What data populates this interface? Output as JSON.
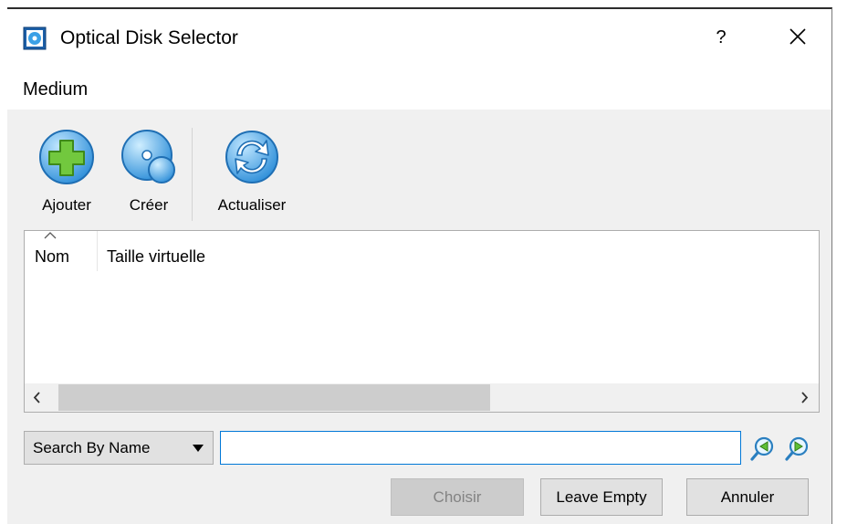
{
  "window": {
    "title": "Optical Disk Selector",
    "help_label": "?"
  },
  "menu": {
    "items": [
      "Medium"
    ]
  },
  "toolbar": {
    "add_label": "Ajouter",
    "create_label": "Créer",
    "refresh_label": "Actualiser"
  },
  "table": {
    "columns": [
      "Nom",
      "Taille virtuelle"
    ],
    "sort_column": "Nom",
    "sort_direction": "ascending",
    "rows": [],
    "hscroll_thumb_fraction": 0.6
  },
  "search": {
    "mode": "Search By Name",
    "value": "",
    "placeholder": ""
  },
  "buttons": {
    "choose": "Choisir",
    "leave_empty": "Leave Empty",
    "cancel": "Annuler"
  },
  "icons": {
    "app": "virtualbox-disk-icon",
    "add": "add-disk-icon",
    "create": "create-disk-icon",
    "refresh": "refresh-icon",
    "search_prev": "search-previous-icon",
    "search_next": "search-next-icon"
  },
  "colors": {
    "accent": "#0078d7",
    "disk_blue": "#3aa0e6",
    "add_green": "#6dc23a",
    "disabled_text": "#838383"
  }
}
